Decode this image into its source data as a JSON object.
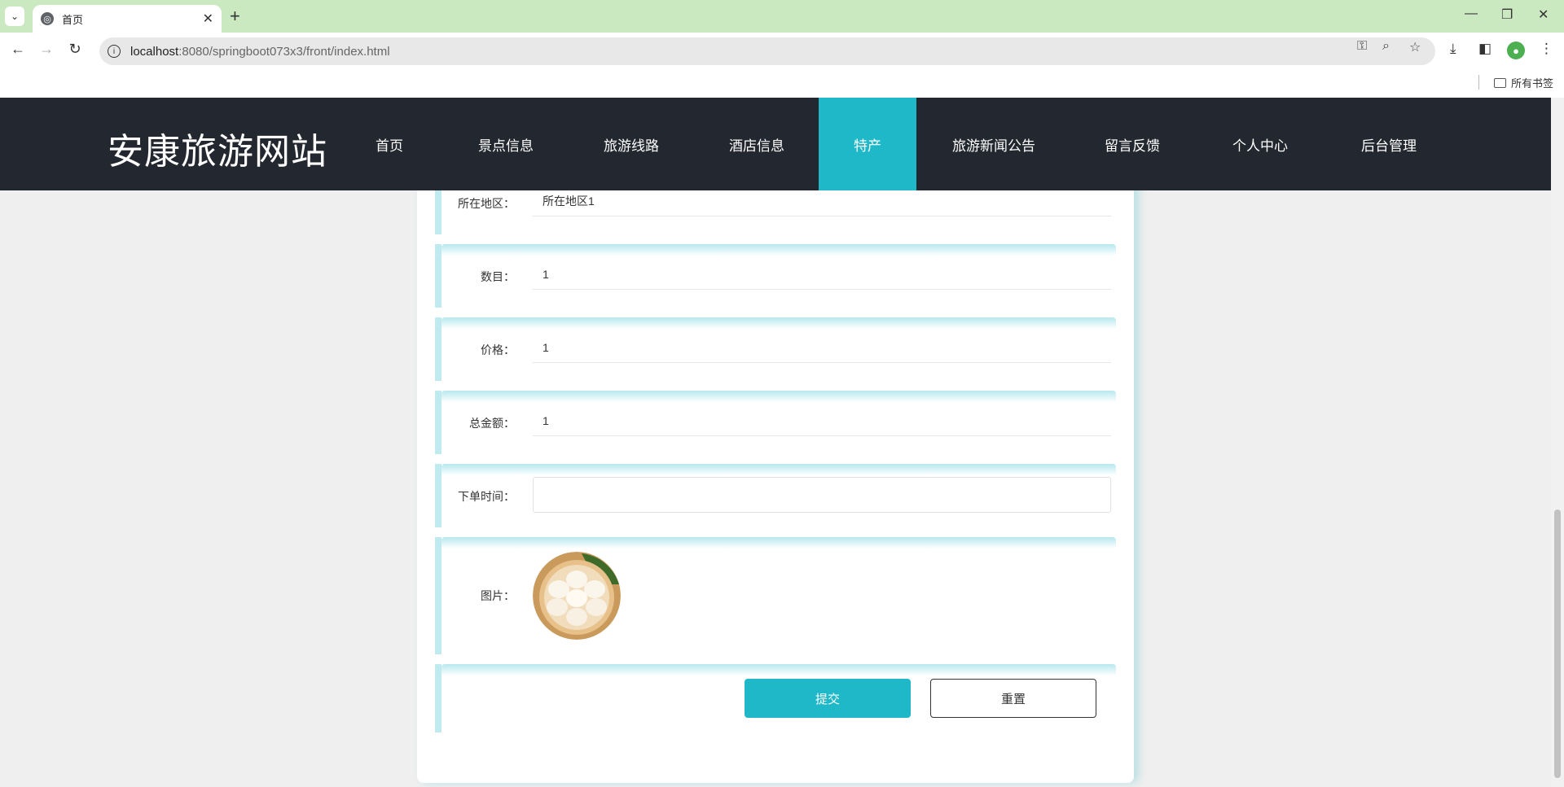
{
  "browser": {
    "tab_title": "首页",
    "url_host": "localhost",
    "url_rest": ":8080/springboot073x3/front/index.html",
    "bookmarks_label": "所有书签"
  },
  "site": {
    "logo": "安康旅游网站",
    "nav": [
      {
        "label": "首页"
      },
      {
        "label": "景点信息"
      },
      {
        "label": "旅游线路"
      },
      {
        "label": "酒店信息"
      },
      {
        "label": "特产",
        "active": true
      },
      {
        "label": "旅游新闻公告"
      },
      {
        "label": "留言反馈"
      },
      {
        "label": "个人中心"
      },
      {
        "label": "后台管理"
      }
    ]
  },
  "form": {
    "region_label": "所在地区：",
    "region_value": "所在地区1",
    "count_label": "数目：",
    "count_value": "1",
    "price_label": "价格：",
    "price_value": "1",
    "total_label": "总金额：",
    "total_value": "1",
    "order_time_label": "下单时间：",
    "order_time_value": "",
    "image_label": "图片：",
    "submit_label": "提交",
    "reset_label": "重置"
  },
  "colors": {
    "accent": "#1eb8c8",
    "header_bg": "#23272f",
    "tabbar_bg": "#cbe9c0"
  },
  "icons": {
    "tab_icon": "globe-icon",
    "back": "back-arrow-icon",
    "forward": "forward-arrow-icon",
    "reload": "reload-icon"
  }
}
